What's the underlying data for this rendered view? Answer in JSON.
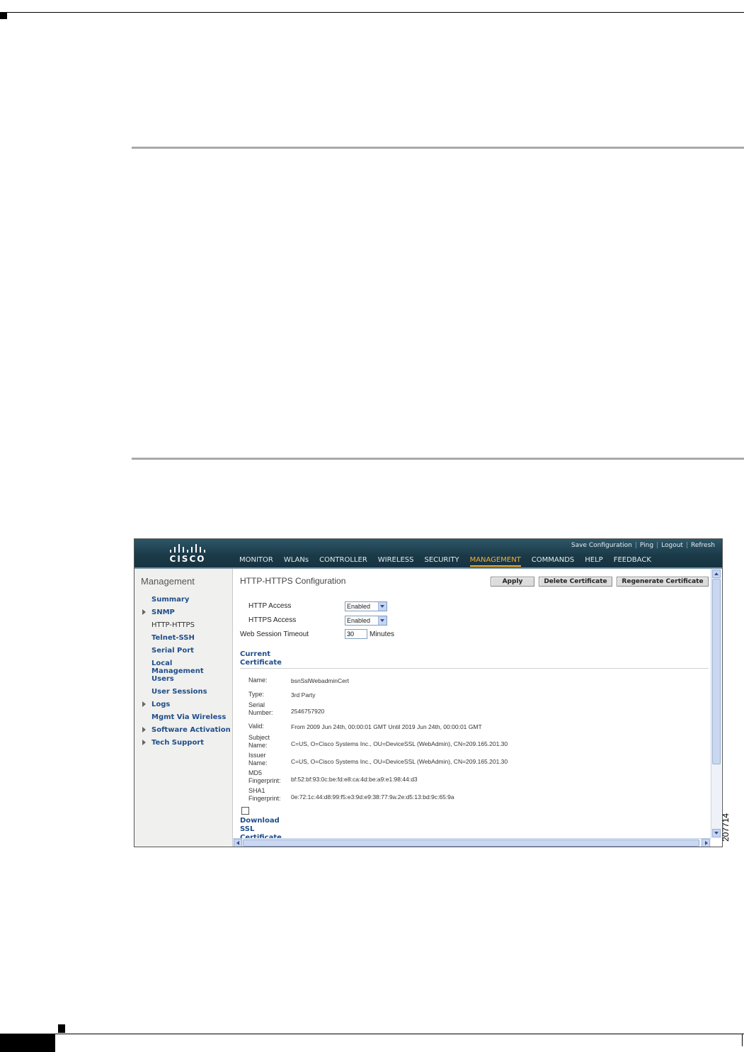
{
  "figure_number": "207714",
  "app": {
    "logo_text": "CISCO",
    "top_links": [
      "Save Configuration",
      "Ping",
      "Logout",
      "Refresh"
    ],
    "nav_tabs": [
      {
        "label": "MONITOR"
      },
      {
        "label": "WLANs"
      },
      {
        "label": "CONTROLLER"
      },
      {
        "label": "WIRELESS"
      },
      {
        "label": "SECURITY"
      },
      {
        "label": "MANAGEMENT",
        "active": true
      },
      {
        "label": "COMMANDS"
      },
      {
        "label": "HELP"
      },
      {
        "label": "FEEDBACK"
      }
    ]
  },
  "sidebar": {
    "title": "Management",
    "items": [
      {
        "label": "Summary",
        "expandable": false
      },
      {
        "label": "SNMP",
        "expandable": true
      },
      {
        "label": "HTTP-HTTPS",
        "expandable": false,
        "selected": true
      },
      {
        "label": "Telnet-SSH",
        "expandable": false
      },
      {
        "label": "Serial Port",
        "expandable": false
      },
      {
        "label": "Local Management Users",
        "expandable": false
      },
      {
        "label": "User Sessions",
        "expandable": false
      },
      {
        "label": "Logs",
        "expandable": true
      },
      {
        "label": "Mgmt Via Wireless",
        "expandable": false
      },
      {
        "label": "Software Activation",
        "expandable": true
      },
      {
        "label": "Tech Support",
        "expandable": true
      }
    ]
  },
  "main": {
    "title": "HTTP-HTTPS Configuration",
    "buttons": {
      "apply": "Apply",
      "delete_certificate": "Delete Certificate",
      "regenerate_certificate": "Regenerate Certificate"
    },
    "http_access": {
      "label": "HTTP Access",
      "value": "Enabled"
    },
    "https_access": {
      "label": "HTTPS Access",
      "value": "Enabled"
    },
    "web_session_timeout": {
      "label": "Web Session Timeout",
      "value": "30",
      "unit": "Minutes"
    },
    "current_certificate_heading": "Current Certificate",
    "certificate": [
      {
        "label": "Name:",
        "value": "bsnSslWebadminCert"
      },
      {
        "label": "Type:",
        "value": "3rd Party"
      },
      {
        "label": "Serial Number:",
        "value": "2546757920"
      },
      {
        "label": "Valid:",
        "value": "From 2009 Jun 24th, 00:00:01 GMT  Until 2019 Jun 24th, 00:00:01 GMT"
      },
      {
        "label": "Subject Name:",
        "value": "C=US, O=Cisco Systems Inc., OU=DeviceSSL (WebAdmin), CN=209.165.201.30"
      },
      {
        "label": "Issuer Name:",
        "value": "C=US, O=Cisco Systems Inc., OU=DeviceSSL (WebAdmin), CN=209.165.201.30"
      },
      {
        "label": "MD5 Fingerprint:",
        "value": "bf:52:bf:93:0c:be:fd:e8:ca:4d:be:a9:e1:98:44:d3"
      },
      {
        "label": "SHA1 Fingerprint:",
        "value": "0e:72:1c:44:d8:99:f5:e3:9d:e9:38:77:9a:2e:d5:13:bd:9c:65:9a"
      }
    ],
    "download_checkbox_checked": false,
    "download_link": "Download SSL Certificate *"
  },
  "colors": {
    "header_bg": "#1a3947",
    "active_tab": "#f7b12e",
    "link_blue": "#1f4e8a",
    "sidebar_bg": "#f0f0ee"
  }
}
